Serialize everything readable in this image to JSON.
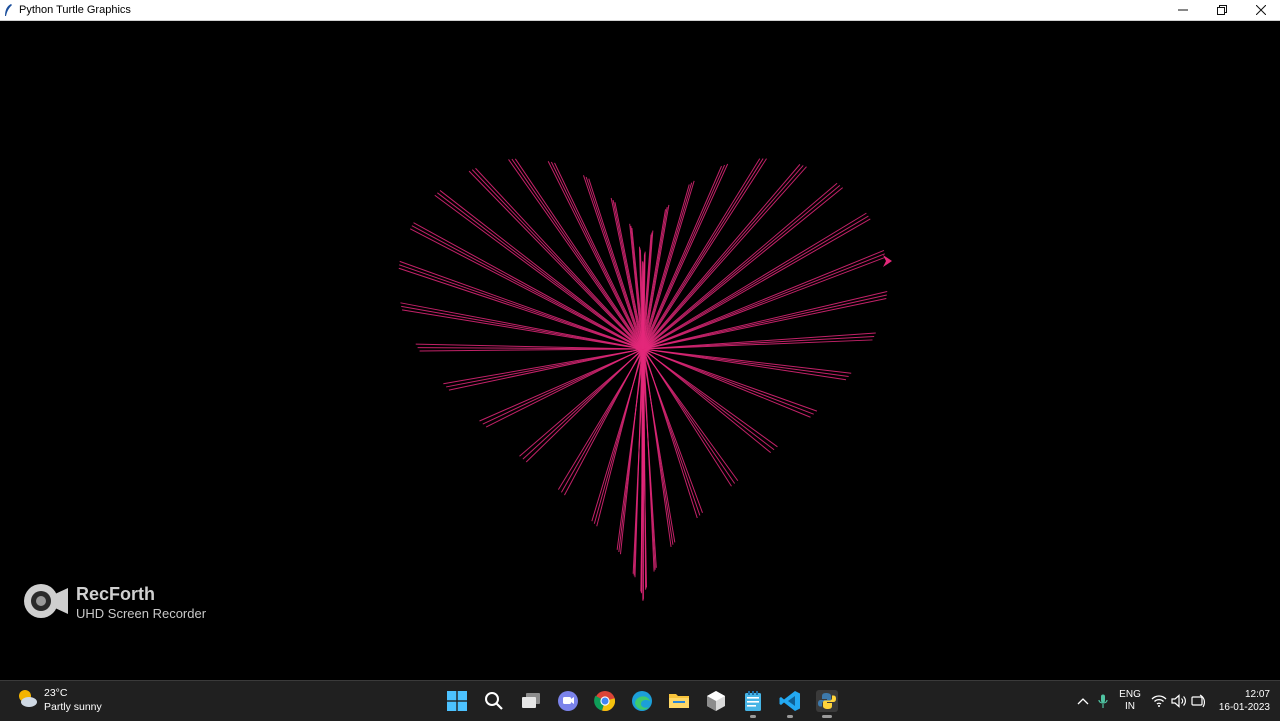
{
  "window": {
    "title": "Python Turtle Graphics",
    "controls": {
      "minimize": "—",
      "restore": "❐",
      "close": "✕"
    }
  },
  "canvas": {
    "background": "#000000",
    "line_color": "#e4287a"
  },
  "watermark": {
    "title": "RecForth",
    "subtitle": "UHD Screen Recorder"
  },
  "taskbar": {
    "weather": {
      "temp": "23°C",
      "desc": "Partly sunny"
    },
    "apps": [
      "windows-start",
      "search",
      "task-view",
      "teams-chat",
      "chrome",
      "edge",
      "file-explorer",
      "unity",
      "notepad",
      "vscode",
      "python-turtle"
    ],
    "language": {
      "line1": "ENG",
      "line2": "IN"
    },
    "clock": {
      "time": "12:07",
      "date": "16-01-2023"
    }
  }
}
